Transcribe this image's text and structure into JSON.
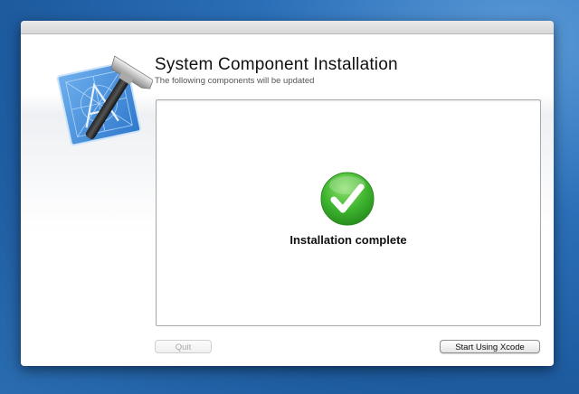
{
  "window": {
    "icon": "xcode-hammer-blueprint-icon",
    "title": "System Component Installation",
    "subtitle": "The following components will be updated"
  },
  "panel": {
    "status_icon": "checkmark-icon",
    "status_text": "Installation complete"
  },
  "buttons": {
    "quit_label": "Quit",
    "start_label": "Start Using Xcode"
  },
  "colors": {
    "check_green": "#3fb52f",
    "blueprint_blue": "#3c86d6",
    "desktop_blue": "#2b6fb8"
  }
}
